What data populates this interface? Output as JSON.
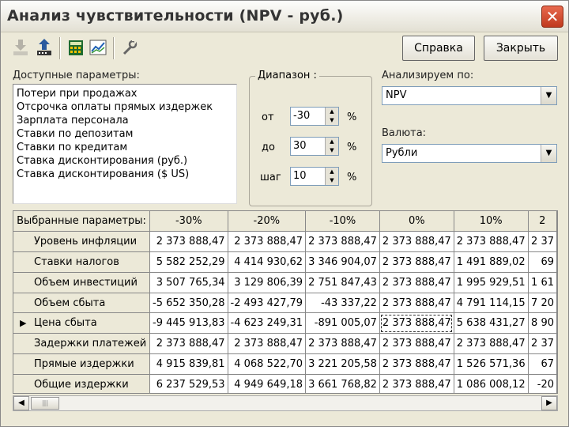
{
  "window": {
    "title": "Анализ чувствительности (NPV - руб.)",
    "close_glyph": "✕"
  },
  "toolbar": {
    "icons": [
      "import-icon",
      "export-icon",
      "calculator-icon",
      "chart-icon",
      "tools-icon"
    ],
    "help_label": "Справка",
    "close_label": "Закрыть"
  },
  "params": {
    "label": "Доступные параметры:",
    "items": [
      "Потери при продажах",
      "Отсрочка оплаты прямых издержек",
      "Зарплата персонала",
      "Ставки по депозитам",
      "Ставки по кредитам",
      "Ставка дисконтирования (руб.)",
      "Ставка дисконтирования ($ US)"
    ]
  },
  "range": {
    "title": "Диапазон :",
    "from_label": "от",
    "from_value": "-30",
    "to_label": "до",
    "to_value": "30",
    "step_label": "шаг",
    "step_value": "10",
    "unit": "%"
  },
  "analyze": {
    "label": "Анализируем по:",
    "value": "NPV"
  },
  "currency": {
    "label": "Валюта:",
    "value": "Рубли"
  },
  "grid": {
    "corner": "Выбранные параметры:",
    "columns": [
      "-30%",
      "-20%",
      "-10%",
      "0%",
      "10%",
      "2"
    ],
    "rows": [
      {
        "name": "Уровень инфляции",
        "marker": "",
        "values": [
          "2 373 888,47",
          "2 373 888,47",
          "2 373 888,47",
          "2 373 888,47",
          "2 373 888,47",
          "2 37"
        ]
      },
      {
        "name": "Ставки налогов",
        "marker": "",
        "values": [
          "5 582 252,29",
          "4 414 930,62",
          "3 346 904,07",
          "2 373 888,47",
          "1 491 889,02",
          "69"
        ]
      },
      {
        "name": "Объем инвестиций",
        "marker": "",
        "values": [
          "3 507 765,34",
          "3 129 806,39",
          "2 751 847,43",
          "2 373 888,47",
          "1 995 929,51",
          "1 61"
        ]
      },
      {
        "name": "Объем сбыта",
        "marker": "",
        "values": [
          "-5 652 350,28",
          "-2 493 427,79",
          "-43 337,22",
          "2 373 888,47",
          "4 791 114,15",
          "7 20"
        ]
      },
      {
        "name": "Цена сбыта",
        "marker": "▶",
        "values": [
          "-9 445 913,83",
          "-4 623 249,31",
          "-891 005,07",
          "2 373 888,47",
          "5 638 431,27",
          "8 90"
        ]
      },
      {
        "name": "Задержки платежей",
        "marker": "",
        "values": [
          "2 373 888,47",
          "2 373 888,47",
          "2 373 888,47",
          "2 373 888,47",
          "2 373 888,47",
          "2 37"
        ]
      },
      {
        "name": "Прямые издержки",
        "marker": "",
        "values": [
          "4 915 839,81",
          "4 068 522,70",
          "3 221 205,58",
          "2 373 888,47",
          "1 526 571,36",
          "67"
        ]
      },
      {
        "name": "Общие издержки",
        "marker": "",
        "values": [
          "6 237 529,53",
          "4 949 649,18",
          "3 661 768,82",
          "2 373 888,47",
          "1 086 008,12",
          "-20"
        ]
      }
    ]
  }
}
